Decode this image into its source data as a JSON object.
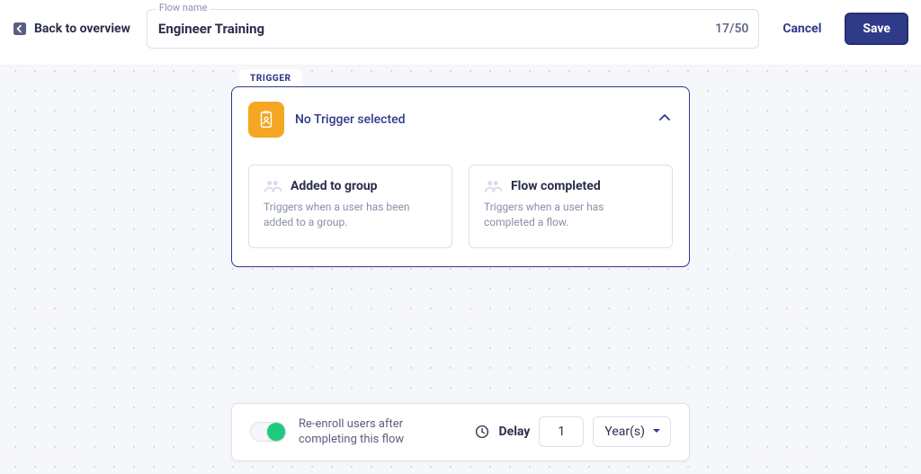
{
  "header": {
    "back_label": "Back to overview",
    "flow_name_label": "Flow name",
    "flow_name_value": "Engineer Training",
    "char_count": "17/50",
    "cancel_label": "Cancel",
    "save_label": "Save"
  },
  "trigger": {
    "tab_label": "TRIGGER",
    "title": "No Trigger selected",
    "options": [
      {
        "title": "Added to group",
        "desc": "Triggers when a user has been added to a group."
      },
      {
        "title": "Flow completed",
        "desc": "Triggers when a user has completed a flow."
      }
    ]
  },
  "reenroll": {
    "label": "Re-enroll users after completing this flow",
    "enabled": true,
    "delay_label": "Delay",
    "delay_value": "1",
    "delay_unit": "Year(s)"
  }
}
